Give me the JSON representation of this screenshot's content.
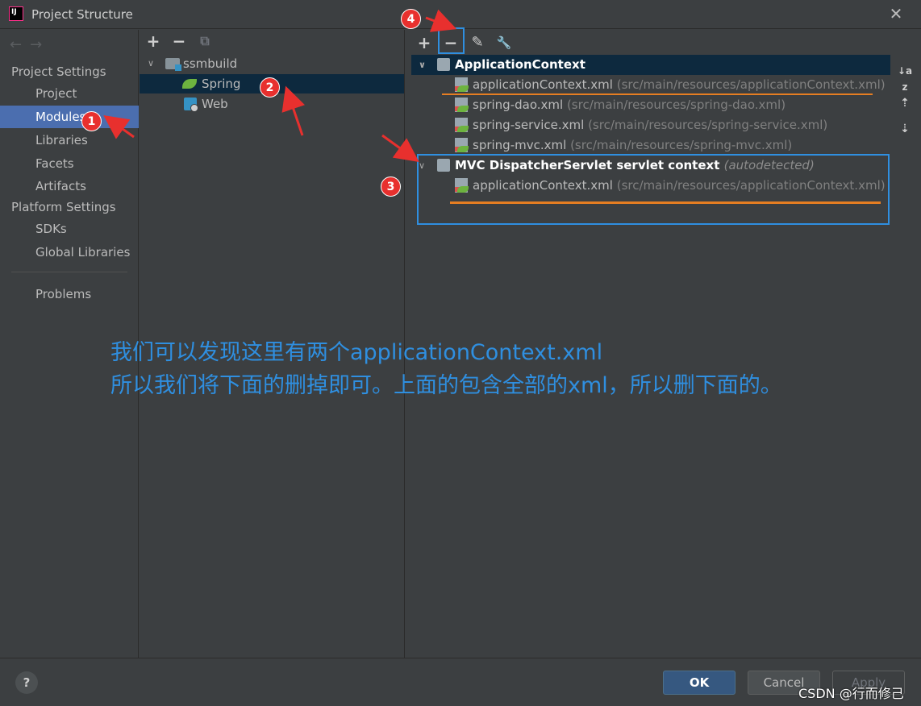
{
  "window": {
    "title": "Project Structure",
    "close": "✕"
  },
  "nav": {
    "back": "←",
    "forward": "→",
    "project_settings": "Project Settings",
    "items_project": [
      "Project",
      "Modules",
      "Libraries",
      "Facets",
      "Artifacts"
    ],
    "platform_settings": "Platform Settings",
    "items_platform": [
      "SDKs",
      "Global Libraries"
    ],
    "problems": "Problems"
  },
  "module_tree": {
    "toolbar": {
      "add": "+",
      "remove": "−",
      "copy": "⧉"
    },
    "root": "ssmbuild",
    "children": [
      "Spring",
      "Web"
    ]
  },
  "context_panel": {
    "toolbar": {
      "add": "+",
      "remove": "−",
      "edit": "✎",
      "wrench": "🔧"
    },
    "groups": [
      {
        "name": "ApplicationContext",
        "files": [
          {
            "file": "applicationContext.xml",
            "path": "(src/main/resources/applicationContext.xml)"
          },
          {
            "file": "spring-dao.xml",
            "path": "(src/main/resources/spring-dao.xml)"
          },
          {
            "file": "spring-service.xml",
            "path": "(src/main/resources/spring-service.xml)"
          },
          {
            "file": "spring-mvc.xml",
            "path": "(src/main/resources/spring-mvc.xml)"
          }
        ]
      },
      {
        "name": "MVC DispatcherServlet servlet context",
        "note": "(autodetected)",
        "files": [
          {
            "file": "applicationContext.xml",
            "path": "(src/main/resources/applicationContext.xml)"
          }
        ]
      }
    ],
    "side_tools": {
      "sort": "↓a z",
      "expand": "⇡",
      "collapse": "⇣"
    }
  },
  "annotation": {
    "line1": "我们可以发现这里有两个applicationContext.xml",
    "line2": "所以我们将下面的删掉即可。上面的包含全部的xml，所以删下面的。",
    "badges": [
      "1",
      "2",
      "3",
      "4"
    ],
    "color": "#2f8fe0"
  },
  "footer": {
    "help": "?",
    "ok": "OK",
    "cancel": "Cancel",
    "apply": "Apply",
    "watermark": "CSDN @行而修己"
  },
  "colors": {
    "selection": "#4b6eaf",
    "tree_selection": "#0d293e",
    "badge": "#e8302e",
    "highlight_line": "#e67e22"
  }
}
